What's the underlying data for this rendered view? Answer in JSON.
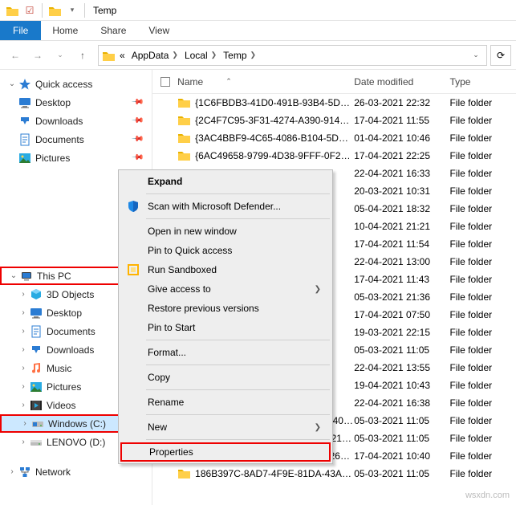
{
  "titlebar": {
    "title": "Temp"
  },
  "ribbon": {
    "file": "File",
    "home": "Home",
    "share": "Share",
    "view": "View"
  },
  "breadcrumb": {
    "hidden_prefix": "«",
    "items": [
      "AppData",
      "Local",
      "Temp"
    ]
  },
  "columns": {
    "name": "Name",
    "date": "Date modified",
    "type": "Type"
  },
  "nav": {
    "quick": "Quick access",
    "desktop": "Desktop",
    "downloads": "Downloads",
    "documents": "Documents",
    "pictures": "Pictures",
    "thispc": "This PC",
    "objects3d": "3D Objects",
    "desktop2": "Desktop",
    "documents2": "Documents",
    "downloads2": "Downloads",
    "music": "Music",
    "pictures2": "Pictures",
    "videos": "Videos",
    "windows_c": "Windows (C:)",
    "lenovo_d": "LENOVO (D:)",
    "network": "Network"
  },
  "files": [
    {
      "name": "{1C6FBDB3-41D0-491B-93B4-5D40D15...",
      "date": "26-03-2021 22:32",
      "type": "File folder"
    },
    {
      "name": "{2C4F7C95-3F31-4274-A390-9148448A...",
      "date": "17-04-2021 11:55",
      "type": "File folder"
    },
    {
      "name": "{3AC4BBF9-4C65-4086-B104-5DF3482...",
      "date": "01-04-2021 10:46",
      "type": "File folder"
    },
    {
      "name": "{6AC49658-9799-4D38-9FFF-0F2DFC0B...",
      "date": "17-04-2021 22:25",
      "type": "File folder"
    },
    {
      "name": "",
      "date": "22-04-2021 16:33",
      "type": "File folder"
    },
    {
      "name": "",
      "date": "20-03-2021 10:31",
      "type": "File folder"
    },
    {
      "name": "",
      "date": "05-04-2021 18:32",
      "type": "File folder"
    },
    {
      "name": "",
      "date": "10-04-2021 21:21",
      "type": "File folder"
    },
    {
      "name": "",
      "date": "17-04-2021 11:54",
      "type": "File folder"
    },
    {
      "name": "",
      "date": "22-04-2021 13:00",
      "type": "File folder"
    },
    {
      "name": "",
      "date": "17-04-2021 11:43",
      "type": "File folder"
    },
    {
      "name": "",
      "date": "05-03-2021 21:36",
      "type": "File folder"
    },
    {
      "name": "",
      "date": "17-04-2021 07:50",
      "type": "File folder"
    },
    {
      "name": "",
      "date": "19-03-2021 22:15",
      "type": "File folder"
    },
    {
      "name": "",
      "date": "05-03-2021 11:05",
      "type": "File folder"
    },
    {
      "name": "",
      "date": "22-04-2021 13:55",
      "type": "File folder"
    },
    {
      "name": "",
      "date": "19-04-2021 10:43",
      "type": "File folder"
    },
    {
      "name": "",
      "date": "22-04-2021 16:38",
      "type": "File folder"
    },
    {
      "name": "17CEB02A-3435-4A86-A202-1640EFE8...",
      "date": "05-03-2021 11:05",
      "type": "File folder"
    },
    {
      "name": "24FB16E1-018F-4726-A1A2-29217664E...",
      "date": "05-03-2021 11:05",
      "type": "File folder"
    },
    {
      "name": "32A1825B-8AD7-4B65-9E8A-E2602FCD...",
      "date": "17-04-2021 10:40",
      "type": "File folder"
    },
    {
      "name": "186B397C-8AD7-4F9E-81DA-43AFF4D...",
      "date": "05-03-2021 11:05",
      "type": "File folder"
    }
  ],
  "context_menu": {
    "expand": "Expand",
    "scan_defender": "Scan with Microsoft Defender...",
    "open_new_window": "Open in new window",
    "pin_quick": "Pin to Quick access",
    "run_sandboxed": "Run Sandboxed",
    "give_access": "Give access to",
    "restore_prev": "Restore previous versions",
    "pin_start": "Pin to Start",
    "format": "Format...",
    "copy": "Copy",
    "rename": "Rename",
    "new": "New",
    "properties": "Properties"
  },
  "watermark": "wsxdn.com"
}
